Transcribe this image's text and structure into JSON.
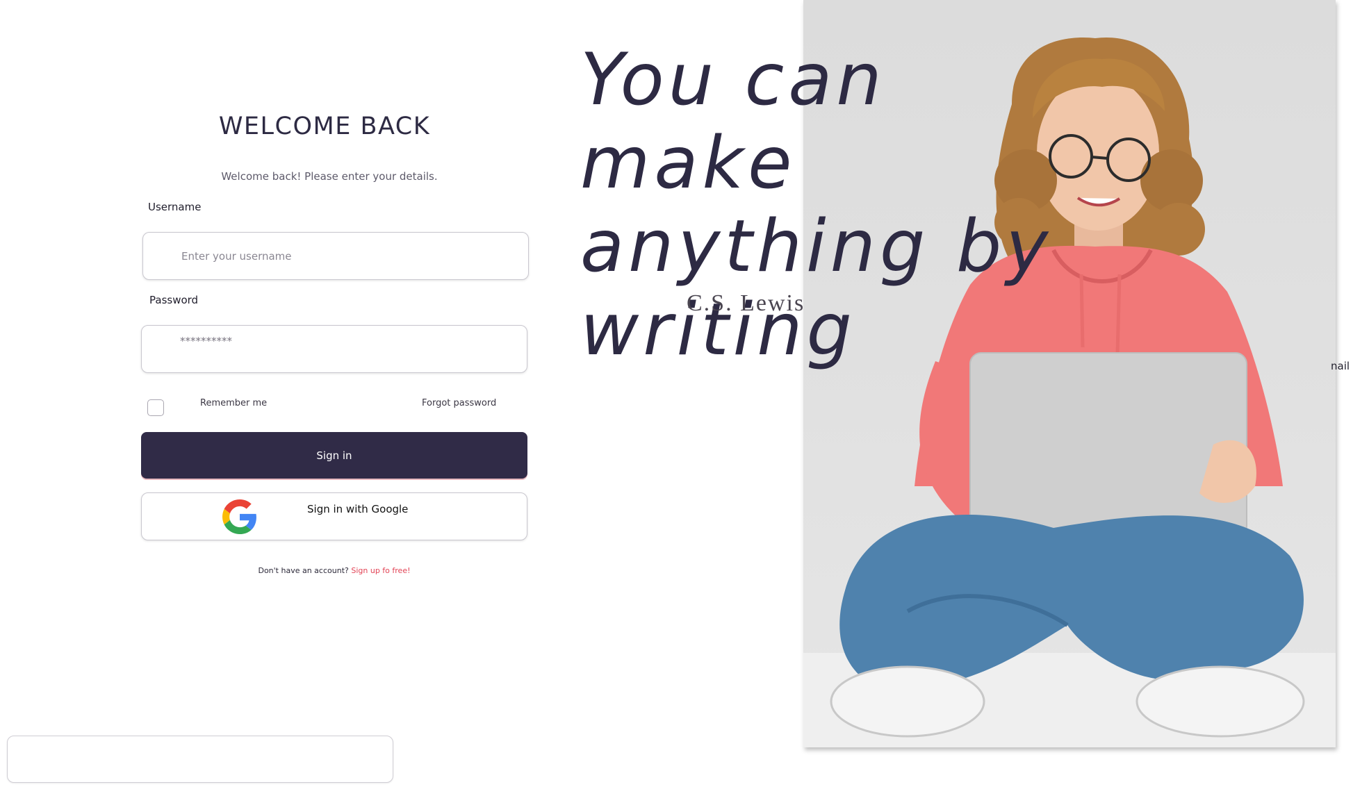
{
  "login": {
    "title": "WELCOME BACK",
    "subtitle": "Welcome back! Please enter your details.",
    "username_label": "Username",
    "username_placeholder": "Enter your username",
    "password_label": "Password",
    "password_value": "**********",
    "remember_label": "Remember me",
    "forgot_label": "Forgot password",
    "signin_label": "Sign in",
    "google_label": "Sign in with Google",
    "signup_prompt": "Don't have an account?",
    "signup_link": "Sign up fo free!"
  },
  "hero": {
    "quote_lines": [
      "You can make",
      "anything by",
      "writing"
    ],
    "quote_author": "C.S. Lewis",
    "edge_text": "nail"
  },
  "icons": {
    "google": "google-g-logo"
  },
  "colors": {
    "primary": "#302b47",
    "link": "#e24355",
    "text": "#2d2a43"
  }
}
